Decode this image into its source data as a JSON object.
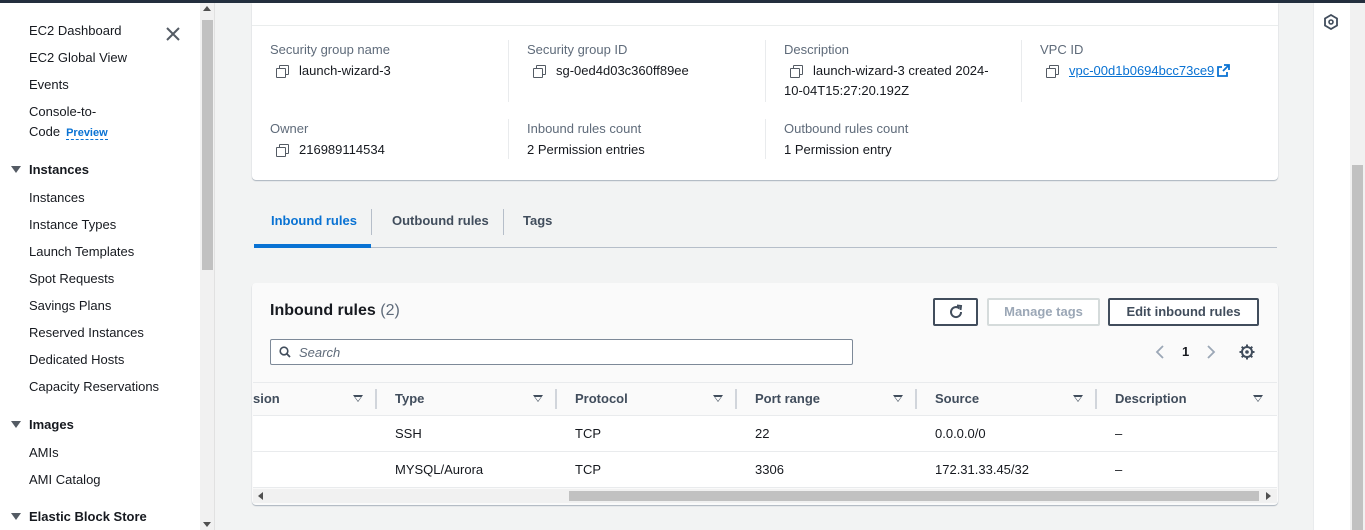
{
  "sidebar": {
    "close_label": "Close navigation",
    "links_top": [
      {
        "label": "EC2 Dashboard"
      },
      {
        "label": "EC2 Global View"
      },
      {
        "label": "Events"
      }
    ],
    "console_to_code": {
      "line1": "Console-to-",
      "line2": "Code",
      "badge": "Preview"
    },
    "sections": [
      {
        "title": "Instances",
        "items": [
          "Instances",
          "Instance Types",
          "Launch Templates",
          "Spot Requests",
          "Savings Plans",
          "Reserved Instances",
          "Dedicated Hosts",
          "Capacity Reservations"
        ]
      },
      {
        "title": "Images",
        "items": [
          "AMIs",
          "AMI Catalog"
        ]
      },
      {
        "title": "Elastic Block Store",
        "items": []
      }
    ]
  },
  "details": {
    "sg_name": {
      "label": "Security group name",
      "value": "launch-wizard-3"
    },
    "sg_id": {
      "label": "Security group ID",
      "value": "sg-0ed4d03c360ff89ee"
    },
    "description": {
      "label": "Description",
      "line1": "launch-wizard-3 created 2024-",
      "line2": "10-04T15:27:20.192Z"
    },
    "vpc": {
      "label": "VPC ID",
      "value": "vpc-00d1b0694bcc73ce9"
    },
    "owner": {
      "label": "Owner",
      "value": "216989114534"
    },
    "inbound_count": {
      "label": "Inbound rules count",
      "value": "2 Permission entries"
    },
    "outbound_count": {
      "label": "Outbound rules count",
      "value": "1 Permission entry"
    }
  },
  "tabs": [
    {
      "label": "Inbound rules",
      "active": true
    },
    {
      "label": "Outbound rules",
      "active": false
    },
    {
      "label": "Tags",
      "active": false
    }
  ],
  "table": {
    "title": "Inbound rules",
    "count": "(2)",
    "buttons": {
      "manage_tags": "Manage tags",
      "edit": "Edit inbound rules"
    },
    "search_placeholder": "Search",
    "page": "1",
    "columns": [
      "sion",
      "Type",
      "Protocol",
      "Port range",
      "Source",
      "Description"
    ],
    "rows": [
      {
        "type": "SSH",
        "protocol": "TCP",
        "port": "22",
        "source": "0.0.0.0/0",
        "description": "–"
      },
      {
        "type": "MYSQL/Aurora",
        "protocol": "TCP",
        "port": "3306",
        "source": "172.31.33.45/32",
        "description": "–"
      }
    ]
  },
  "colors": {
    "accent": "#0972d3",
    "text": "#16191f",
    "muted": "#5f6b7a",
    "border": "#414d5c"
  }
}
